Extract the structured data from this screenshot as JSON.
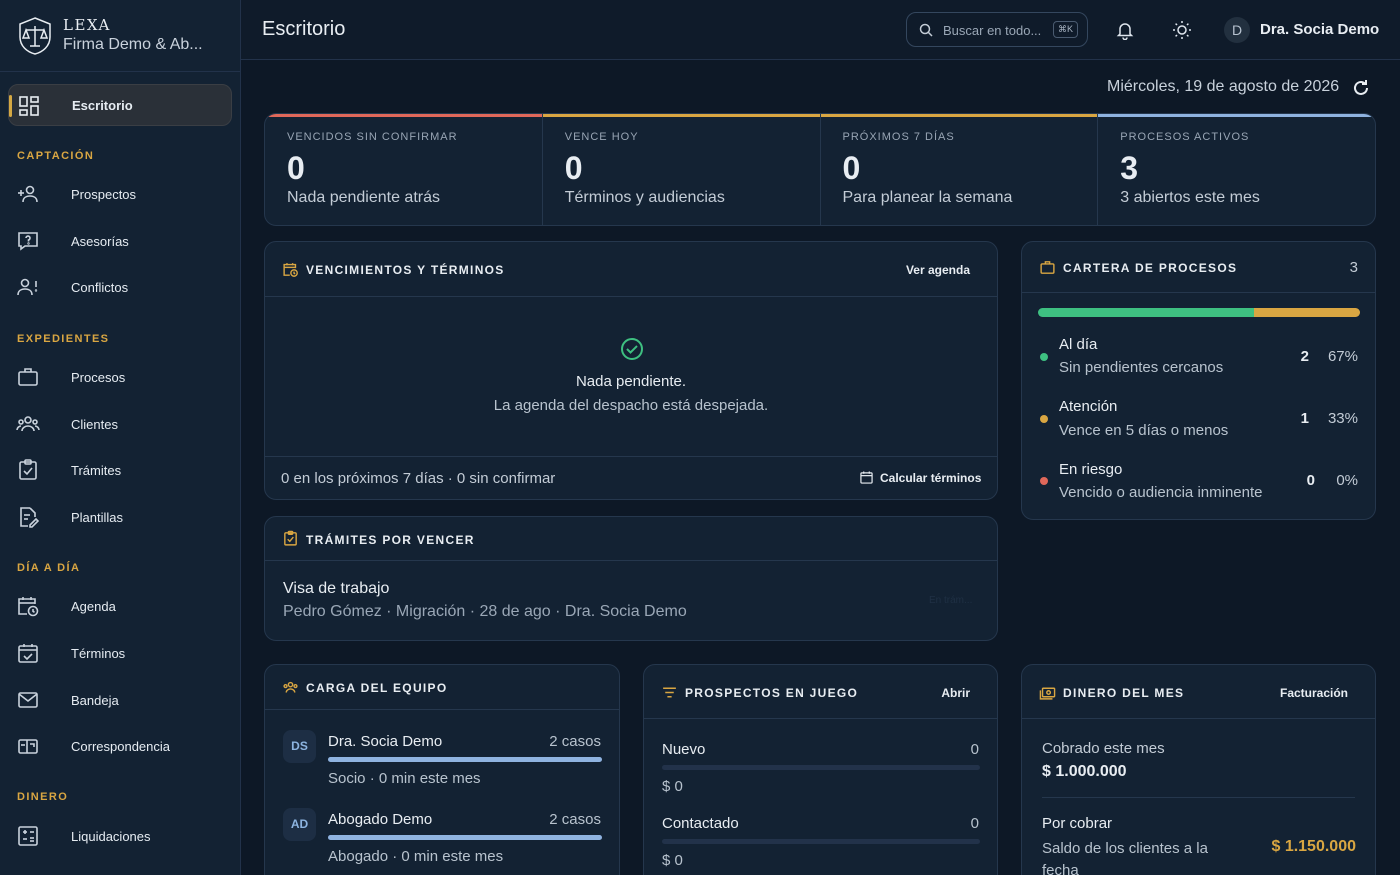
{
  "brand": {
    "name": "LEXA",
    "firm": "Firma Demo & Ab..."
  },
  "sidebar": {
    "active": "Escritorio",
    "sections": [
      {
        "title": "CAPTACIÓN",
        "items": [
          "Prospectos",
          "Asesorías",
          "Conflictos"
        ]
      },
      {
        "title": "EXPEDIENTES",
        "items": [
          "Procesos",
          "Clientes",
          "Trámites",
          "Plantillas"
        ]
      },
      {
        "title": "DÍA A DÍA",
        "items": [
          "Agenda",
          "Términos",
          "Bandeja",
          "Correspondencia"
        ]
      },
      {
        "title": "DINERO",
        "items": [
          "Liquidaciones"
        ]
      }
    ]
  },
  "topbar": {
    "title": "Escritorio",
    "search_placeholder": "Buscar en todo...",
    "search_shortcut": "⌘K",
    "user_initial": "D",
    "user_name": "Dra. Socia Demo"
  },
  "date": "Miércoles, 19 de agosto de 2026",
  "stats": [
    {
      "caption": "VENCIDOS SIN CONFIRMAR",
      "value": "0",
      "sub": "Nada pendiente atrás",
      "color": "#e0685a"
    },
    {
      "caption": "VENCE HOY",
      "value": "0",
      "sub": "Términos y audiencias",
      "color": "#d9a642"
    },
    {
      "caption": "PRÓXIMOS 7 DÍAS",
      "value": "0",
      "sub": "Para planear la semana",
      "color": "#d9a642"
    },
    {
      "caption": "PROCESOS ACTIVOS",
      "value": "3",
      "sub": "3 abiertos este mes",
      "color": "#8fb3e0"
    }
  ],
  "vencimientos": {
    "title": "VENCIMIENTOS Y TÉRMINOS",
    "action": "Ver agenda",
    "empty_title": "Nada pendiente.",
    "empty_sub": "La agenda del despacho está despejada.",
    "footer": "0 en los próximos 7 días · 0 sin confirmar",
    "footer_action": "Calcular términos"
  },
  "tramites": {
    "title": "TRÁMITES POR VENCER",
    "item_title": "Visa de trabajo",
    "item_meta": "Pedro Gómez · Migración · 28 de ago · Dra. Socia Demo",
    "item_status": "En trám..."
  },
  "cartera": {
    "title": "CARTERA DE PROCESOS",
    "count": "3",
    "segments": [
      {
        "label": "Al día",
        "sub": "Sin pendientes cercanos",
        "count": "2",
        "pct": "67%",
        "color": "#3ec081",
        "fraction": 0.67
      },
      {
        "label": "Atención",
        "sub": "Vence en 5 días o menos",
        "count": "1",
        "pct": "33%",
        "color": "#d9a642",
        "fraction": 0.33
      },
      {
        "label": "En riesgo",
        "sub": "Vencido o audiencia inminente",
        "count": "0",
        "pct": "0%",
        "color": "#e0685a",
        "fraction": 0
      }
    ]
  },
  "equipo": {
    "title": "CARGA DEL EQUIPO",
    "members": [
      {
        "initials": "DS",
        "name": "Dra. Socia Demo",
        "cases": "2 casos",
        "meta": "Socio · 0 min este mes",
        "load": 1.0
      },
      {
        "initials": "AD",
        "name": "Abogado Demo",
        "cases": "2 casos",
        "meta": "Abogado · 0 min este mes",
        "load": 1.0
      }
    ]
  },
  "prospectos": {
    "title": "PROSPECTOS EN JUEGO",
    "action": "Abrir",
    "stages": [
      {
        "name": "Nuevo",
        "count": "0",
        "amount": "$ 0"
      },
      {
        "name": "Contactado",
        "count": "0",
        "amount": "$ 0"
      }
    ]
  },
  "dinero": {
    "title": "DINERO DEL MES",
    "action": "Facturación",
    "cobrado_label": "Cobrado este mes",
    "cobrado_value": "$ 1.000.000",
    "por_cobrar_label": "Por cobrar",
    "por_cobrar_sub": "Saldo de los clientes a la fecha",
    "por_cobrar_value": "$ 1.150.000"
  }
}
